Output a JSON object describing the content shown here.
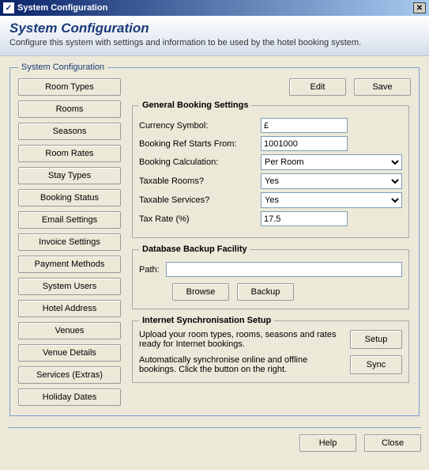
{
  "window": {
    "title": "System Configuration",
    "close_glyph": "✕",
    "app_icon_glyph": "✓"
  },
  "header": {
    "title": "System Configuration",
    "subtitle": "Configure this system with settings and information to be used by the hotel booking system."
  },
  "fieldset_legend": "System Configuration",
  "nav": [
    "Room Types",
    "Rooms",
    "Seasons",
    "Room Rates",
    "Stay Types",
    "Booking Status",
    "Email Settings",
    "Invoice Settings",
    "Payment Methods",
    "System Users",
    "Hotel Address",
    "Venues",
    "Venue Details",
    "Services (Extras)",
    "Holiday Dates"
  ],
  "actions": {
    "edit": "Edit",
    "save": "Save"
  },
  "general": {
    "legend": "General Booking Settings",
    "currency_label": "Currency Symbol:",
    "currency_value": "£",
    "ref_label": "Booking Ref Starts From:",
    "ref_value": "1001000",
    "calc_label": "Booking Calculation:",
    "calc_value": "Per Room",
    "tax_rooms_label": "Taxable Rooms?",
    "tax_rooms_value": "Yes",
    "tax_services_label": "Taxable Services?",
    "tax_services_value": "Yes",
    "tax_rate_label": "Tax Rate (%)",
    "tax_rate_value": "17.5"
  },
  "backup": {
    "legend": "Database Backup Facility",
    "path_label": "Path:",
    "path_value": "",
    "browse": "Browse",
    "backup": "Backup"
  },
  "sync": {
    "legend": "Internet Synchronisation Setup",
    "setup_text": "Upload your room types, rooms, seasons and rates ready for Internet bookings.",
    "setup_btn": "Setup",
    "sync_text": "Automatically synchronise online and offline bookings. Click the button on the right.",
    "sync_btn": "Sync"
  },
  "footer": {
    "help": "Help",
    "close": "Close"
  }
}
